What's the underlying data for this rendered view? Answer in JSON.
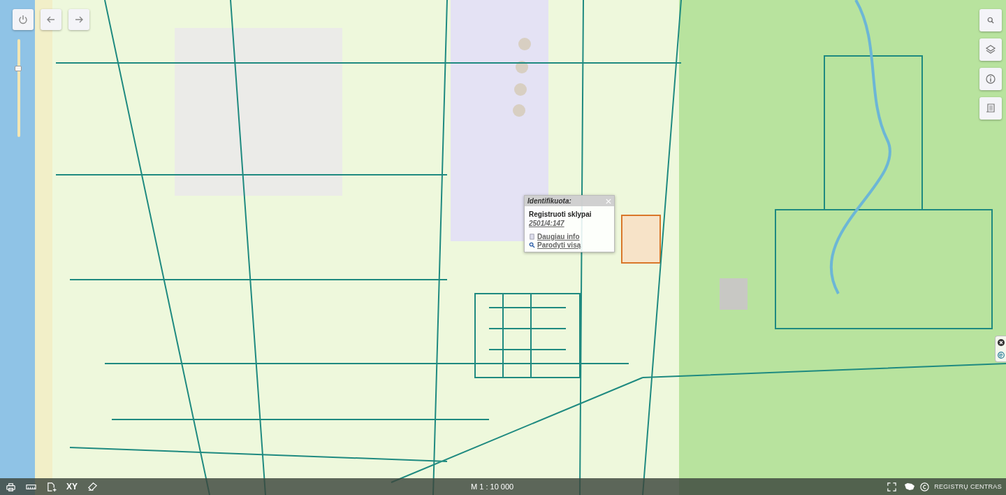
{
  "map_controls": {
    "zoom_slider": {
      "level": 0.7
    }
  },
  "popup": {
    "title": "Identifikuota:",
    "layer": "Registruoti sklypai",
    "parcel": "2501/4:147",
    "links": [
      {
        "kind": "info",
        "label": "Daugiau info"
      },
      {
        "kind": "zoom",
        "label": "Parodyti visą"
      }
    ]
  },
  "status_bar": {
    "coordinates_button": "XY",
    "scale": "M 1 : 10 000",
    "copyright": "REGISTRŲ CENTRAS"
  }
}
